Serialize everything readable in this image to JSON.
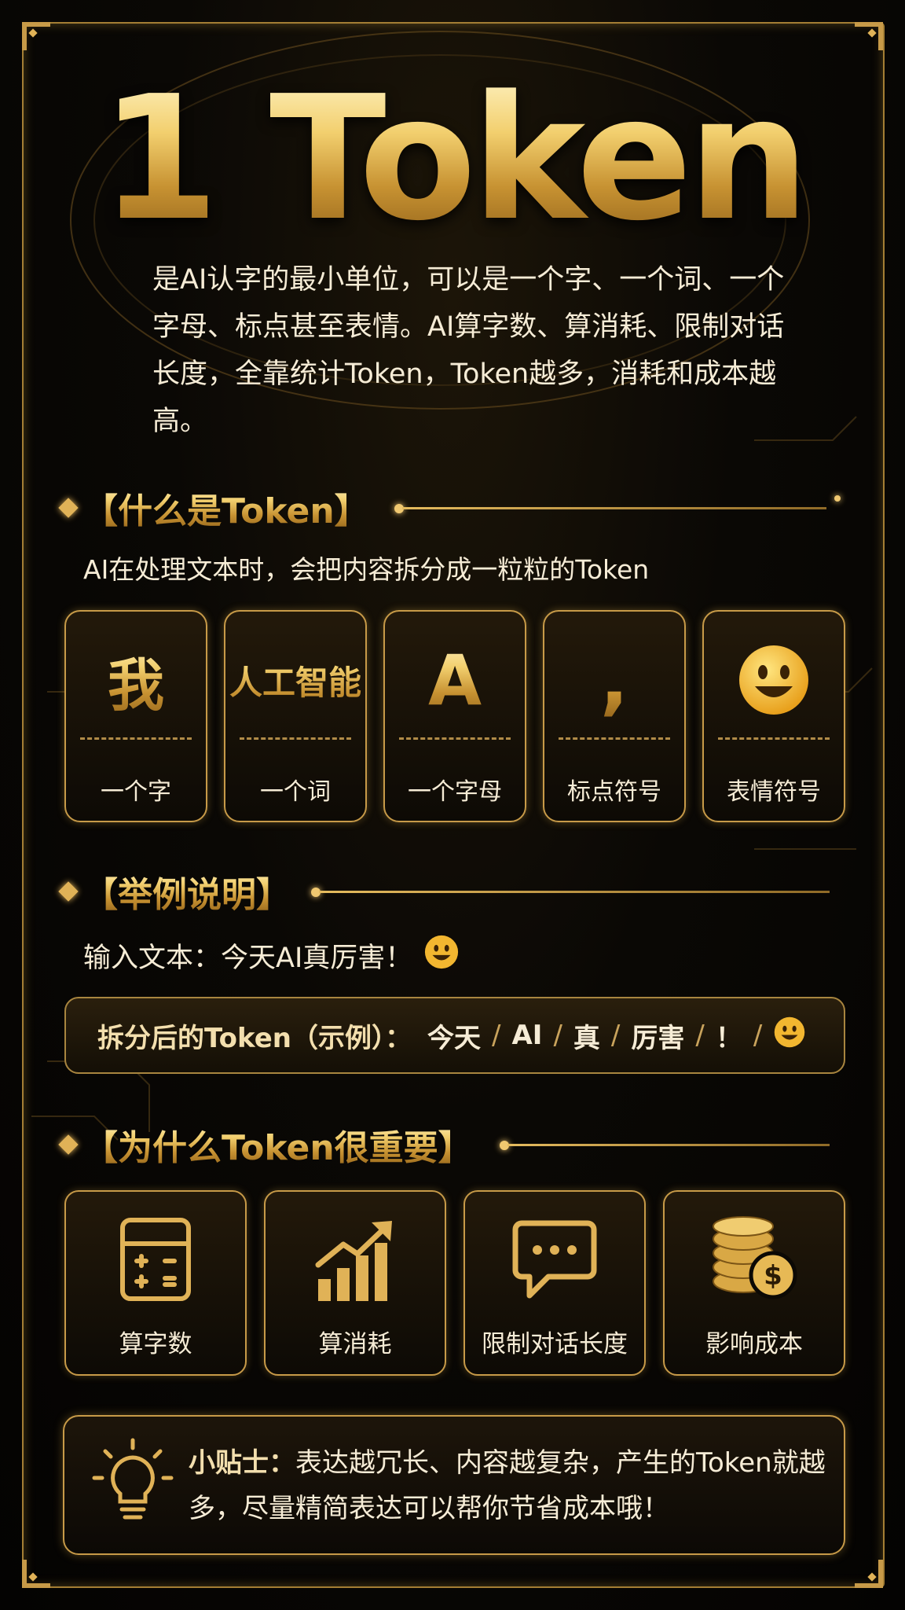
{
  "title": "1 Token",
  "intro": "是AI认字的最小单位，可以是一个字、一个词、一个字母、标点甚至表情。AI算字数、算消耗、限制对话长度，全靠统计Token，Token越多，消耗和成本越高。",
  "section1": {
    "heading": "【什么是Token】",
    "subtitle": "AI在处理文本时，会把内容拆分成一粒粒的Token",
    "tiles": [
      {
        "glyph": "我",
        "dash": "-------",
        "label": "一个字"
      },
      {
        "glyph": "人工智能",
        "dash": "-------",
        "label": "一个词"
      },
      {
        "glyph": "A",
        "dash": "-------",
        "label": "一个字母"
      },
      {
        "glyph": ",",
        "dash": "-------",
        "label": "标点符号"
      },
      {
        "glyph_icon": "smiley-emoji-icon",
        "dash": "-------",
        "label": "表情符号"
      }
    ]
  },
  "section2": {
    "heading": "【举例说明】",
    "input_text": "输入文本：今天AI真厉害！",
    "split_prefix": "拆分后的Token（示例）：",
    "tokens": [
      "今天",
      "AI",
      "真",
      "厉害",
      "！"
    ],
    "separator": "/"
  },
  "section3": {
    "heading": "【为什么Token很重要】",
    "features": [
      {
        "icon": "calculator-icon",
        "label": "算字数"
      },
      {
        "icon": "rising-bar-chart-icon",
        "label": "算消耗"
      },
      {
        "icon": "chat-bubble-icon",
        "label": "限制对话长度"
      },
      {
        "icon": "coins-dollar-icon",
        "label": "影响成本"
      }
    ]
  },
  "tip": {
    "icon": "lightbulb-icon",
    "label": "小贴士：",
    "text": "表达越冗长、内容越复杂，产生的Token就越多，尽量精简表达可以帮你节省成本哦！"
  },
  "colors": {
    "gold": "#e0b257",
    "gold_light": "#f3dfae",
    "background": "#050403",
    "text": "#f6ecd6"
  }
}
